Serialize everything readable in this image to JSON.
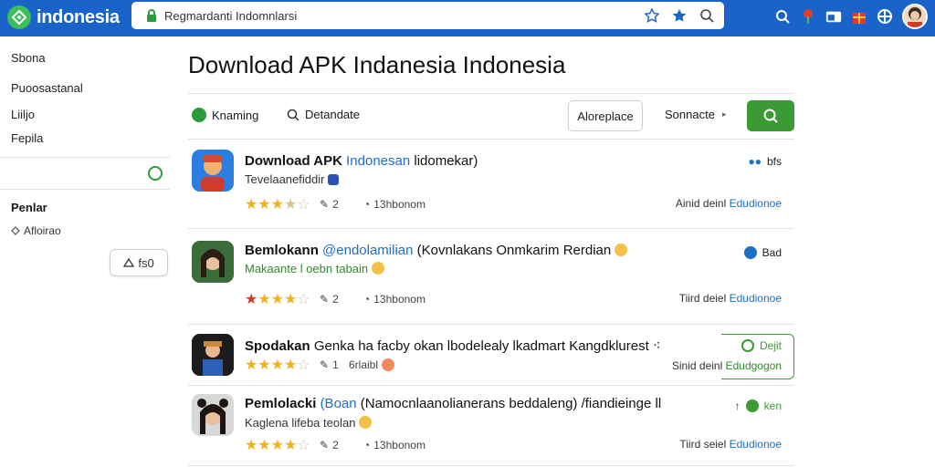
{
  "header": {
    "logo": "indonesia",
    "address": "Regmardanti Indomnlarsi"
  },
  "sidebar": {
    "items": [
      "Sbona",
      "Puoosastanal",
      "Liiljo",
      "Fepila"
    ],
    "heading": "Penlar",
    "link": "Afloirao",
    "pill": "fs0"
  },
  "main": {
    "title": "Download APK Indanesia Indonesia",
    "filters": {
      "chip1": "Knaming",
      "chip2": "Detandate",
      "replace": "Aloreplace",
      "sort": "Sonnacte"
    },
    "rows": [
      {
        "title_bold": "Download APK",
        "title_blue": "Indonesan",
        "title_rest": "lidomekar)",
        "subtitle": "Tevelaanefiddir",
        "rating": 3.5,
        "comments": "2",
        "downloads": "13hbonom",
        "right_label": "Ainid deinl",
        "right_value": "Edudionoe",
        "badge": "bfs",
        "badge_color": "#1e6ec8"
      },
      {
        "title_bold": "Bemlokann",
        "title_blue": "@endolamilian",
        "title_rest": "(Kovnlakans Onmkarim Rerdian",
        "subtitle": "Makaante  l oebn tabain",
        "rating": 4,
        "comments": "2",
        "downloads": "13hbonom",
        "right_label": "Tiird deiel",
        "right_value": "Edudionoe",
        "badge": "Bad",
        "badge_color": "#1e6ec8"
      },
      {
        "title_bold": "Spodakan",
        "title_blue": "",
        "title_rest": "Genka ha facby okan lbodelealy lkadmart Kangdklurest",
        "subtitle": "",
        "rating": 4,
        "comments": "1",
        "downloads": "6rlaibl",
        "right_label": "Sinid deinl",
        "right_value": "Edudgogon",
        "badge": "Dejit",
        "badge_color": "#3c9a34"
      },
      {
        "title_bold": "Pemlolacki",
        "title_blue": "(Boan",
        "title_rest": "(Namocnlaanolianerans beddaleng) /fiandieinge ll",
        "subtitle": "Kaglena   lifeba teolan",
        "rating": 4,
        "comments": "2",
        "downloads": "13hbonom",
        "right_label": "Tiird seiel",
        "right_value": "Edudionoe",
        "badge": "ken",
        "badge_color": "#3c9a34"
      }
    ]
  },
  "colors": {
    "topbar": "#1a63c9",
    "accent_green": "#3c9a34",
    "star": "#f2b21a",
    "link_blue": "#1e6ec8"
  }
}
